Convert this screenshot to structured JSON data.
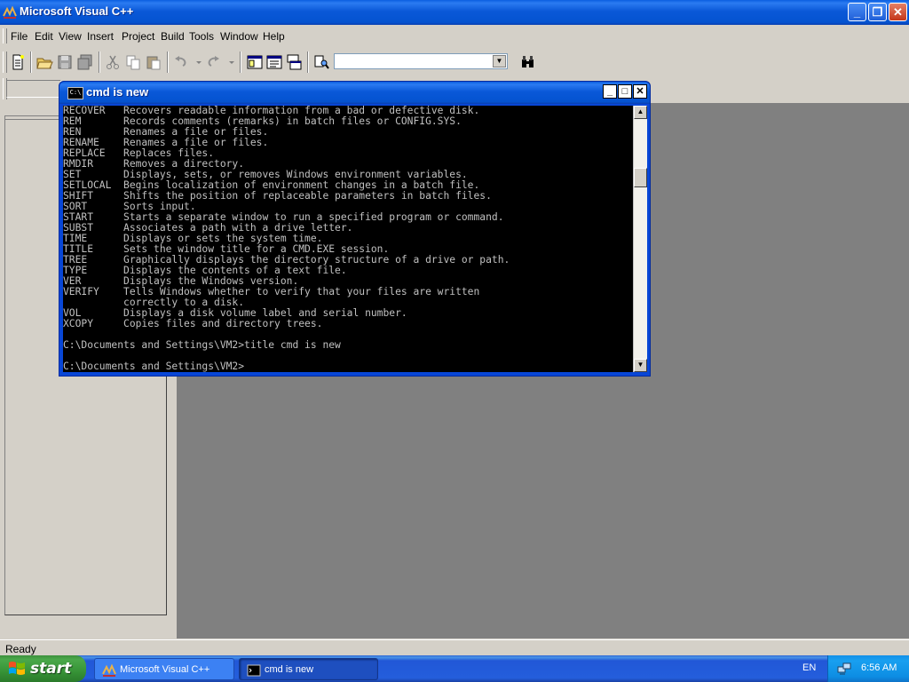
{
  "main_window": {
    "title": "Microsoft Visual C++",
    "buttons": {
      "minimize": "_",
      "maximize": "❐",
      "close": "✕"
    }
  },
  "menu": [
    {
      "label": "File"
    },
    {
      "label": "Edit"
    },
    {
      "label": "View"
    },
    {
      "label": "Insert"
    },
    {
      "label": "Project"
    },
    {
      "label": "Build"
    },
    {
      "label": "Tools"
    },
    {
      "label": "Window"
    },
    {
      "label": "Help"
    }
  ],
  "toolbar": {
    "find_combo_value": "",
    "wizard_combo_value": ""
  },
  "cmd_window": {
    "title": "cmd is new",
    "icon_text": "C:\\",
    "buttons": {
      "minimize": "_",
      "maximize": "□",
      "close": "✕"
    },
    "lines": [
      "RECOVER   Recovers readable information from a bad or defective disk.",
      "REM       Records comments (remarks) in batch files or CONFIG.SYS.",
      "REN       Renames a file or files.",
      "RENAME    Renames a file or files.",
      "REPLACE   Replaces files.",
      "RMDIR     Removes a directory.",
      "SET       Displays, sets, or removes Windows environment variables.",
      "SETLOCAL  Begins localization of environment changes in a batch file.",
      "SHIFT     Shifts the position of replaceable parameters in batch files.",
      "SORT      Sorts input.",
      "START     Starts a separate window to run a specified program or command.",
      "SUBST     Associates a path with a drive letter.",
      "TIME      Displays or sets the system time.",
      "TITLE     Sets the window title for a CMD.EXE session.",
      "TREE      Graphically displays the directory structure of a drive or path.",
      "TYPE      Displays the contents of a text file.",
      "VER       Displays the Windows version.",
      "VERIFY    Tells Windows whether to verify that your files are written",
      "          correctly to a disk.",
      "VOL       Displays a disk volume label and serial number.",
      "XCOPY     Copies files and directory trees.",
      "",
      "C:\\Documents and Settings\\VM2>title cmd is new",
      "",
      "C:\\Documents and Settings\\VM2>"
    ]
  },
  "status": {
    "text": "Ready"
  },
  "taskbar": {
    "start_label": "start",
    "tasks": [
      {
        "label": "Microsoft Visual C++"
      },
      {
        "label": "cmd is new"
      }
    ],
    "language": "EN",
    "clock": "6:56 AM"
  },
  "colors": {
    "titlebar_blue": "#0453d0",
    "console_bg": "#000000",
    "console_fg": "#c0c0c0",
    "mdi_background": "#808080",
    "start_green": "#379437"
  }
}
